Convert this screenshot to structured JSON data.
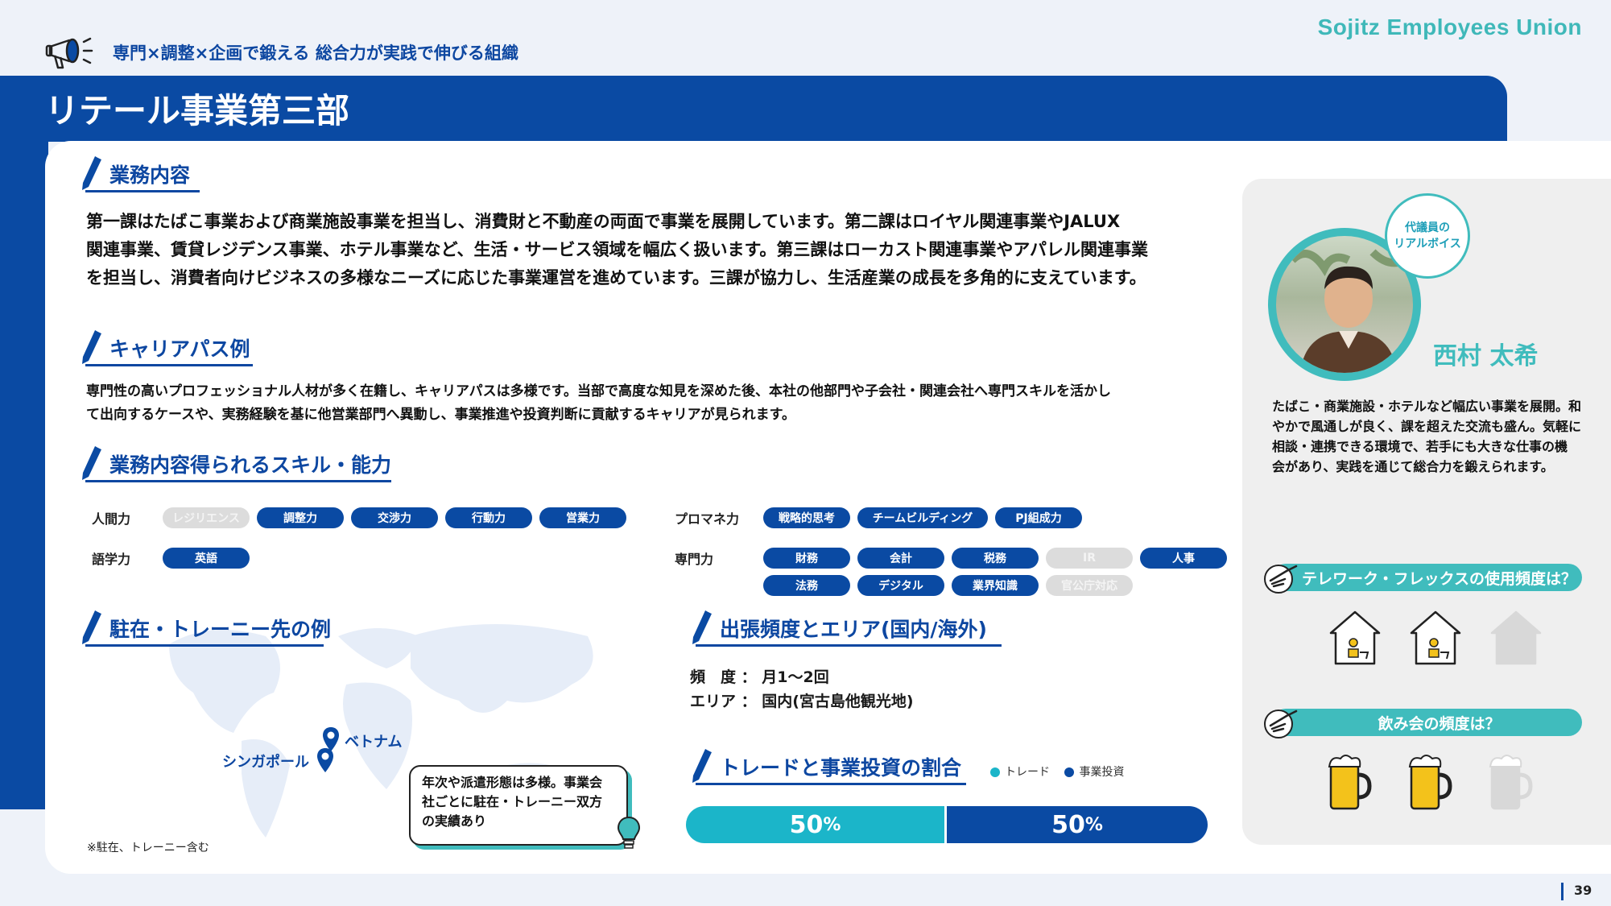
{
  "brand": {
    "text": "Sojitz Employees Union"
  },
  "header": {
    "tagline": "専門×調整×企画で鍛える 総合力が実践で伸びる組織",
    "title": "リテール事業第三部"
  },
  "business": {
    "heading": "業務内容",
    "lines": [
      "第一課はたばこ事業および商業施設事業を担当し、消費財と不動産の両面で事業を展開しています。第二課はロイヤル関連事業やJALUX",
      "関連事業、賃貸レジデンス事業、ホテル事業など、生活・サービス領域を幅広く扱います。第三課はローカスト関連事業やアパレル関連事業",
      "を担当し、消費者向けビジネスの多様なニーズに応じた事業運営を進めています。三課が協力し、生活産業の成長を多角的に支えています。"
    ]
  },
  "career": {
    "heading": "キャリアパス例",
    "lines": [
      "専門性の高いプロフェッショナル人材が多く在籍し、キャリアパスは多様です。当部で高度な知見を深めた後、本社の他部門や子会社・関連会社へ専門スキルを活かし",
      "て出向するケースや、実務経験を基に他営業部門へ異動し、事業推進や投資判断に貢献するキャリアが見られます。"
    ]
  },
  "skills": {
    "heading": "業務内容得られるスキル・能力",
    "groups": [
      {
        "label": "人間力",
        "items": [
          {
            "text": "レジリエンス",
            "on": false
          },
          {
            "text": "調整力",
            "on": true
          },
          {
            "text": "交渉力",
            "on": true
          },
          {
            "text": "行動力",
            "on": true
          },
          {
            "text": "営業力",
            "on": true
          }
        ]
      },
      {
        "label": "語学力",
        "items": [
          {
            "text": "英語",
            "on": true
          }
        ]
      },
      {
        "label": "プロマネ力",
        "items": [
          {
            "text": "戦略的思考",
            "on": true
          },
          {
            "text": "チームビルディング",
            "on": true
          },
          {
            "text": "PJ組成力",
            "on": true
          }
        ]
      },
      {
        "label": "専門力",
        "items": [
          {
            "text": "財務",
            "on": true
          },
          {
            "text": "会計",
            "on": true
          },
          {
            "text": "税務",
            "on": true
          },
          {
            "text": "IR",
            "on": false
          },
          {
            "text": "人事",
            "on": true
          },
          {
            "text": "法務",
            "on": true
          },
          {
            "text": "デジタル",
            "on": true
          },
          {
            "text": "業界知識",
            "on": true
          },
          {
            "text": "官公庁対応",
            "on": false
          }
        ]
      }
    ]
  },
  "overseas": {
    "heading": "駐在・トレーニー先の例",
    "pins": [
      "ベトナム",
      "シンガポール"
    ],
    "note": [
      "年次や派遣形態は多様。事業会",
      "社ごとに駐在・トレーニー双方",
      "の実績あり"
    ],
    "footnote": "※駐在、トレーニー含む"
  },
  "travel": {
    "heading": "出張頻度とエリア(国内/海外)",
    "freq_label": "頻　度 ：",
    "freq_value": "月1～2回",
    "area_label": "エリア ：",
    "area_value": "国内(宮古島他観光地)"
  },
  "ratio": {
    "heading": "トレードと事業投資の割合",
    "legend": [
      "トレード",
      "事業投資"
    ],
    "colors": [
      "#1bb5c9",
      "#0a4aa3"
    ],
    "trade_value": "50",
    "invest_value": "50",
    "unit": "%",
    "trade_fraction": 0.5
  },
  "voice": {
    "bubble": [
      "代議員の",
      "リアルボイス"
    ],
    "name": "西村 太希",
    "comment": [
      "たばこ・商業施設・ホテルなど幅広い事業を展開。和",
      "やかで風通しが良く、課を超えた交流も盛ん。気軽に",
      "相談・連携できる環境で、若手にも大きな仕事の機",
      "会があり、実践を通じて総合力を鍛えられます。"
    ]
  },
  "telework": {
    "question": "テレワーク・フレックスの使用頻度は？",
    "level": 2,
    "max": 3
  },
  "drinking": {
    "question": "飲み会の頻度は？",
    "level": 2,
    "max": 3
  },
  "footer": {
    "page": "39"
  }
}
